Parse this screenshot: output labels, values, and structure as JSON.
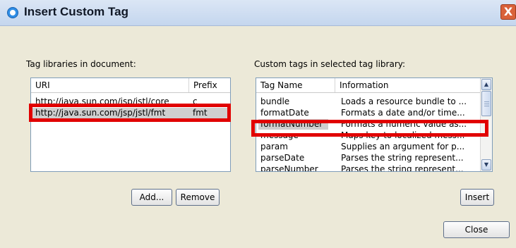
{
  "window": {
    "title": "Insert Custom Tag",
    "close_label": "X"
  },
  "left_panel": {
    "label": "Tag libraries in document:",
    "columns": [
      "URI",
      "Prefix"
    ],
    "rows": [
      {
        "uri": "http://java.sun.com/jsp/jstl/core",
        "prefix": "c"
      },
      {
        "uri": "http://java.sun.com/jsp/jstl/fmt",
        "prefix": "fmt"
      }
    ],
    "selected_index": 1,
    "add_label": "Add...",
    "remove_label": "Remove"
  },
  "right_panel": {
    "label": "Custom tags in selected tag library:",
    "columns": [
      "Tag Name",
      "Information"
    ],
    "rows": [
      {
        "name": "bundle",
        "info": "Loads a resource bundle to ..."
      },
      {
        "name": "formatDate",
        "info": "Formats a date and/or time..."
      },
      {
        "name": "formatNumber",
        "info": "Formats a numeric value as..."
      },
      {
        "name": "message",
        "info": "Maps key to localized mess..."
      },
      {
        "name": "param",
        "info": "Supplies an argument for p..."
      },
      {
        "name": "parseDate",
        "info": "Parses the string represent..."
      },
      {
        "name": "parseNumber",
        "info": "Parses the string represent..."
      }
    ],
    "selected_index": 2,
    "insert_label": "Insert"
  },
  "close_button_label": "Close",
  "colors": {
    "highlight": "#e10000",
    "selection": "#cfcfcf",
    "dialog_background": "#ece9d8"
  },
  "icons": {
    "title_icon": "app-circle-icon",
    "scroll_up": "chevron-up-icon",
    "scroll_down": "chevron-down-icon"
  }
}
